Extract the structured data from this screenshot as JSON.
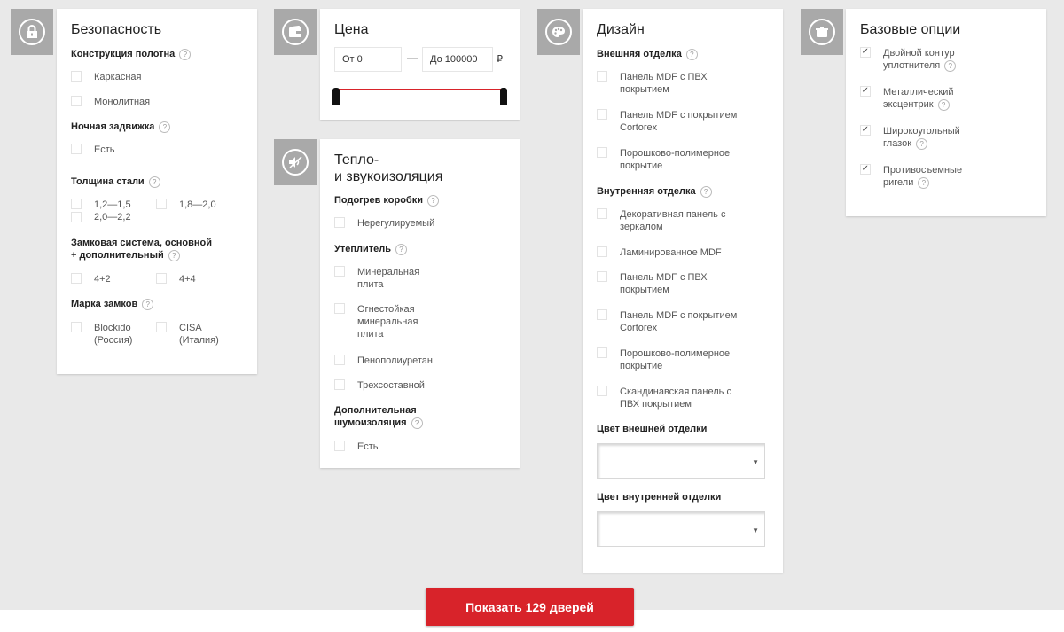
{
  "security": {
    "title": "Безопасность",
    "construction": {
      "title": "Конструкция полотна",
      "options": [
        "Каркасная",
        "Монолитная"
      ]
    },
    "night_latch": {
      "title": "Ночная задвижка",
      "options": [
        "Есть"
      ]
    },
    "steel_thickness": {
      "title": "Толщина стали",
      "options": [
        "1,2—1,5\n2,0—2,2",
        "1,8—2,0"
      ]
    },
    "lock_system": {
      "title_line1": "Замковая система, основной",
      "title_line2": "+ дополнительный",
      "options": [
        "4+2",
        "4+4"
      ]
    },
    "lock_brand": {
      "title": "Марка замков",
      "options": [
        "Blockido\n(Россия)",
        "CISA\n(Италия)"
      ]
    }
  },
  "price": {
    "title": "Цена",
    "from_value": "От 0",
    "to_value": "До 100000",
    "currency": "₽"
  },
  "insulation": {
    "title_line1": "Тепло-",
    "title_line2": "и звукоизоляция",
    "box_heating": {
      "title": "Подогрев коробки",
      "options": [
        "Нерегулируемый"
      ]
    },
    "insulator": {
      "title": "Утеплитель",
      "options": [
        "Минеральная\nплита",
        "Огнестойкая\nминеральная\nплита",
        "Пенополиуретан",
        "Трехсоставной"
      ]
    },
    "noise": {
      "title_line1": "Дополнительная",
      "title_line2": "шумоизоляция",
      "options": [
        "Есть"
      ]
    }
  },
  "design": {
    "title": "Дизайн",
    "outer": {
      "title": "Внешняя отделка",
      "options": [
        "Панель MDF с ПВХ\nпокрытием",
        "Панель MDF с покрытием\nCortorex",
        "Порошково-полимерное\nпокрытие"
      ]
    },
    "inner": {
      "title": "Внутренняя отделка",
      "options": [
        "Декоративная панель с\nзеркалом",
        "Ламинированное MDF",
        "Панель MDF с ПВХ\nпокрытием",
        "Панель MDF с покрытием\nCortorex",
        "Порошково-полимерное\nпокрытие",
        "Скандинавская панель с\nПВХ покрытием"
      ]
    },
    "outer_color": {
      "label": "Цвет внешней отделки",
      "value": ""
    },
    "inner_color": {
      "label": "Цвет внутренней отделки",
      "value": ""
    }
  },
  "base_options": {
    "title": "Базовые опции",
    "check_mark": "✓",
    "options": [
      {
        "label": "Двойной контур\nуплотнителя",
        "checked": true
      },
      {
        "label": "Металлический\nэксцентрик",
        "checked": true
      },
      {
        "label": "Широкоугольный\nглазок",
        "checked": true
      },
      {
        "label": "Противосъемные\nригели",
        "checked": true
      }
    ]
  },
  "help_symbol": "?",
  "submit_label": "Показать 129 дверей",
  "colors": {
    "accent": "#d8232a",
    "icon_bg": "#a9a9a9",
    "page_bg": "#e9e9e9"
  }
}
